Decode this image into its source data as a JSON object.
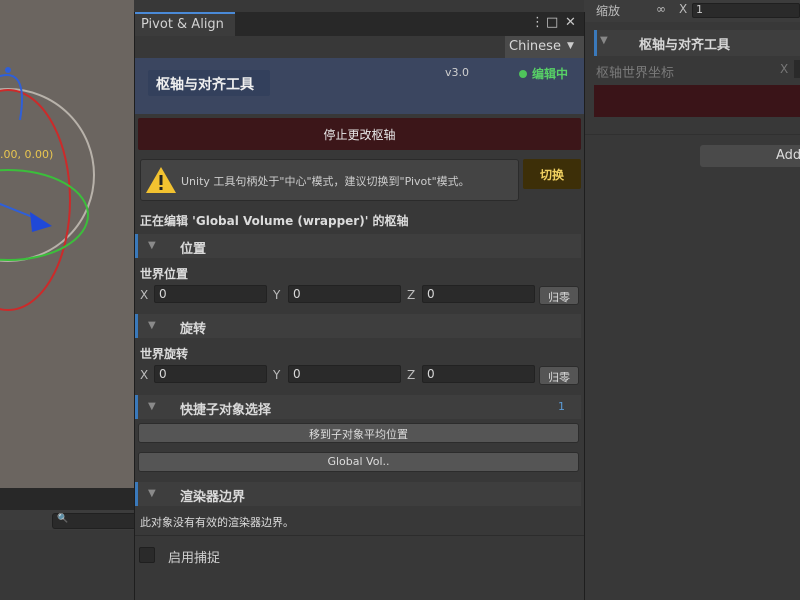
{
  "scene": {
    "coord_text": ".00, 0.00)",
    "search_icon": "search-icon"
  },
  "inspector": {
    "field_label": "缩放",
    "x_label": "X",
    "x_value": "1",
    "header_title": "枢轴与对齐工具",
    "world_coord_label": "枢轴世界坐标",
    "world_x_label": "X",
    "add_button": "Add"
  },
  "window": {
    "tab_label": "Pivot & Align",
    "language": "Chinese"
  },
  "header": {
    "title": "枢轴与对齐工具",
    "version": "v3.0",
    "status": "编辑中",
    "status_color": "#57d066"
  },
  "stop_button": "停止更改枢轴",
  "warning": {
    "message": "Unity 工具句柄处于\"中心\"模式，建议切换到\"Pivot\"模式。",
    "switch_label": "切换"
  },
  "editing_label": "正在编辑 'Global Volume (wrapper)' 的枢轴",
  "position": {
    "section": "位置",
    "sub_label": "世界位置",
    "x_label": "X",
    "x": "0",
    "y_label": "Y",
    "y": "0",
    "z_label": "Z",
    "z": "0",
    "reset": "归零"
  },
  "rotation": {
    "section": "旋转",
    "sub_label": "世界旋转",
    "x_label": "X",
    "x": "0",
    "y_label": "Y",
    "y": "0",
    "z_label": "Z",
    "z": "0",
    "reset": "归零"
  },
  "children": {
    "section": "快捷子对象选择",
    "count": "1",
    "move_button": "移到子对象平均位置",
    "child_button": "Global Vol.."
  },
  "renderer": {
    "section": "渲染器边界",
    "message": "此对象没有有效的渲染器边界。"
  },
  "snap": {
    "label": "启用捕捉"
  }
}
